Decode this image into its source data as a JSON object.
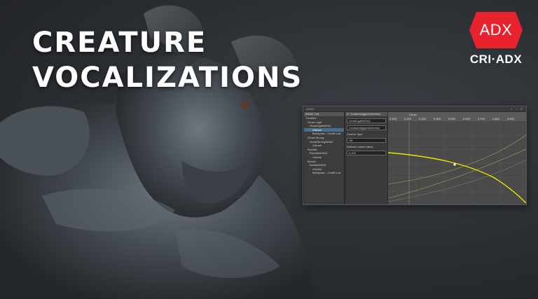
{
  "title_lines": [
    "CREATURE",
    "VOCALIZATIONS"
  ],
  "logo": {
    "badge": "ADX",
    "text": "CRI·ADX",
    "color": "#e8232d"
  },
  "editor": {
    "window_title": "AISAC",
    "tree_header": "AISAC List",
    "tree_items": [
      "Creature",
      "Growl Light",
      "GrowlLightAISAC",
      "Volume",
      "Bandpass - Cutoff Low",
      "Growl Strong",
      "GrowlStrongAISAC",
      "Volume",
      "Rumble",
      "RumbleAISAC",
      "Volume",
      "Breath",
      "BreathAISAC",
      "Volume",
      "Bandpass - Cutoff Low"
    ],
    "selected_index": 3,
    "props_header": "0: CreatureAggressiveness",
    "prop_name": "GrowlLightAISAC",
    "prop_control": "CreatureAggressiveness",
    "control_type_label": "Control Type",
    "control_type_value": "Off",
    "default_control_label": "Default Control Value",
    "default_control_value": "0.000",
    "ruler_ticks": [
      "0.100",
      "0.200",
      "0.300",
      "0.400",
      "0.500",
      "0.600",
      "0.700",
      "0.800",
      "0.900"
    ],
    "ruler_label": "Curve",
    "curve_color": "#f2e200"
  }
}
